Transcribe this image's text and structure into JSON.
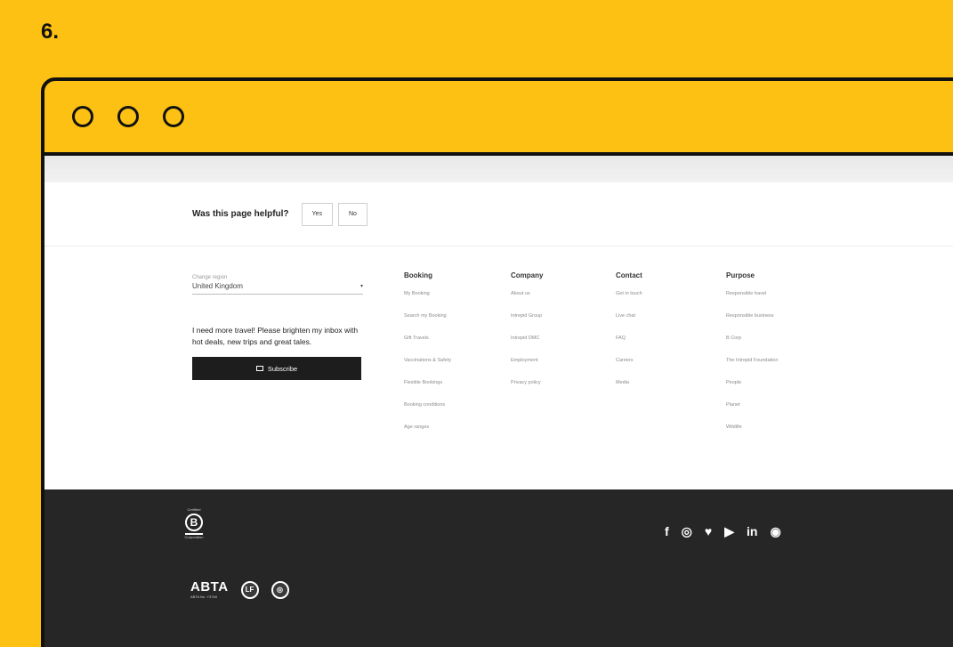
{
  "step_number": "6.",
  "feedback": {
    "question": "Was this page helpful?",
    "yes_label": "Yes",
    "no_label": "No"
  },
  "country": {
    "label": "Change region",
    "value": "United Kingdom",
    "arrow": "▾"
  },
  "newsletter": {
    "promo": "I need more travel! Please brighten my inbox with hot deals, new trips and great tales.",
    "subscribe_label": "Subscribe"
  },
  "columns": [
    {
      "title": "Booking",
      "links": [
        "My Booking",
        "Search my Booking",
        "Gift Travels",
        "Vaccinations & Safety",
        "Flexible Bookings",
        "Booking conditions",
        "Age ranges"
      ]
    },
    {
      "title": "Company",
      "links": [
        "About us",
        "Intrepid Group",
        "Intrepid DMC",
        "Employment",
        "Privacy policy"
      ]
    },
    {
      "title": "Contact",
      "links": [
        "Get in touch",
        "Live chat",
        "FAQ",
        "Careers",
        "Media"
      ]
    },
    {
      "title": "Purpose",
      "links": [
        "Responsible travel",
        "Responsible business",
        "B Corp",
        "The Intrepid Foundation",
        "People",
        "Planet",
        "Wildlife"
      ]
    }
  ],
  "footer": {
    "bcorp": {
      "top": "Certified",
      "letter": "B",
      "bottom": "Corporation"
    },
    "abta": {
      "main": "ABTA",
      "sub": "ABTA No. Y3748"
    },
    "badge2": "LF",
    "badge3": "◎",
    "social_icons": [
      "facebook-icon",
      "instagram-icon",
      "twitter-icon",
      "youtube-icon",
      "linkedin-icon",
      "messenger-icon"
    ],
    "social_glyphs": [
      "f",
      "◎",
      "♥",
      "▶",
      "in",
      "◉"
    ]
  }
}
